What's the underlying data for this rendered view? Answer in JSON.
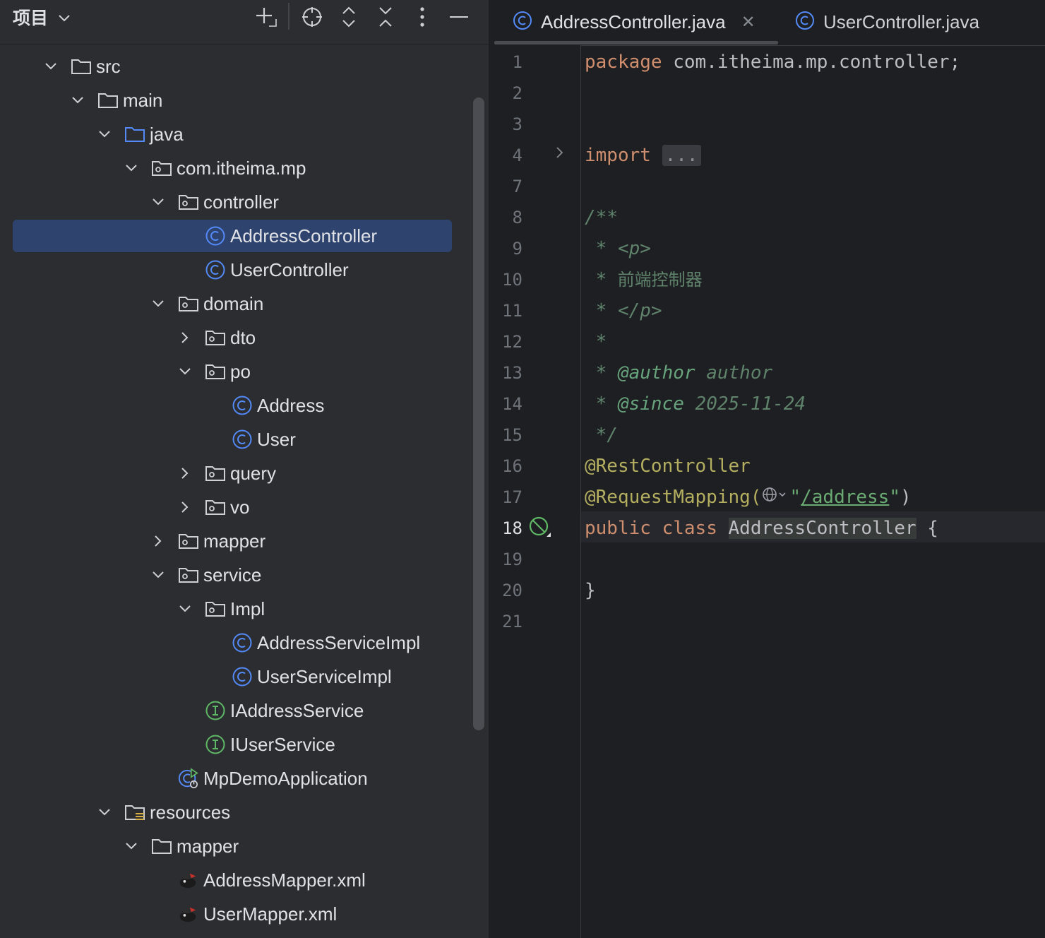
{
  "project_panel": {
    "title": "项目",
    "toolbar": [
      "add",
      "locate",
      "expand-all",
      "collapse-all",
      "options",
      "hide"
    ],
    "tree": [
      {
        "label": "src",
        "icon": "folder",
        "expanded": true
      },
      {
        "label": "main",
        "icon": "folder",
        "expanded": true
      },
      {
        "label": "java",
        "icon": "source-folder",
        "expanded": true
      },
      {
        "label": "com.itheima.mp",
        "icon": "package",
        "expanded": true
      },
      {
        "label": "controller",
        "icon": "package",
        "expanded": true
      },
      {
        "label": "AddressController",
        "icon": "class",
        "selected": true
      },
      {
        "label": "UserController",
        "icon": "class"
      },
      {
        "label": "domain",
        "icon": "package",
        "expanded": true
      },
      {
        "label": "dto",
        "icon": "package",
        "expanded": false
      },
      {
        "label": "po",
        "icon": "package",
        "expanded": true
      },
      {
        "label": "Address",
        "icon": "class"
      },
      {
        "label": "User",
        "icon": "class"
      },
      {
        "label": "query",
        "icon": "package",
        "expanded": false
      },
      {
        "label": "vo",
        "icon": "package",
        "expanded": false
      },
      {
        "label": "mapper",
        "icon": "package",
        "expanded": false
      },
      {
        "label": "service",
        "icon": "package",
        "expanded": true
      },
      {
        "label": "Impl",
        "icon": "package",
        "expanded": true
      },
      {
        "label": "AddressServiceImpl",
        "icon": "class"
      },
      {
        "label": "UserServiceImpl",
        "icon": "class"
      },
      {
        "label": "IAddressService",
        "icon": "interface"
      },
      {
        "label": "IUserService",
        "icon": "interface"
      },
      {
        "label": "MpDemoApplication",
        "icon": "spring-boot-class"
      },
      {
        "label": "resources",
        "icon": "resources-folder",
        "expanded": true
      },
      {
        "label": "mapper",
        "icon": "folder",
        "expanded": true
      },
      {
        "label": "AddressMapper.xml",
        "icon": "mybatis-xml"
      },
      {
        "label": "UserMapper.xml",
        "icon": "mybatis-xml"
      }
    ]
  },
  "editor": {
    "tabs": [
      {
        "label": "AddressController.java",
        "active": true,
        "icon": "class"
      },
      {
        "label": "UserController.java",
        "active": false,
        "icon": "class"
      }
    ],
    "current_line": "18",
    "lines": [
      {
        "n": "1",
        "text": "package com.itheima.mp.controller;"
      },
      {
        "n": "2",
        "text": ""
      },
      {
        "n": "3",
        "text": ""
      },
      {
        "n": "4",
        "text": "import ..."
      },
      {
        "n": "7",
        "text": ""
      },
      {
        "n": "8",
        "text": "/**"
      },
      {
        "n": "9",
        "text": " * <p>"
      },
      {
        "n": "10",
        "text": " *  前端控制器"
      },
      {
        "n": "11",
        "text": " * </p>"
      },
      {
        "n": "12",
        "text": " *"
      },
      {
        "n": "13",
        "text": " * @author author"
      },
      {
        "n": "14",
        "text": " * @since 2025-11-24"
      },
      {
        "n": "15",
        "text": " */"
      },
      {
        "n": "16",
        "text": "@RestController"
      },
      {
        "n": "17",
        "text": "@RequestMapping(\"/address\")"
      },
      {
        "n": "18",
        "text": "public class AddressController {"
      },
      {
        "n": "19",
        "text": ""
      },
      {
        "n": "20",
        "text": "}"
      },
      {
        "n": "21",
        "text": ""
      }
    ],
    "tokens": {
      "package_kw": "package",
      "package_name": " com.itheima.mp.controller;",
      "import_kw": "import",
      "import_fold": "...",
      "doc_open": "/**",
      "doc_p_open": " * <p>",
      "doc_star": " *",
      "doc_desc": "  前端控制器",
      "doc_p_close": " * </p>",
      "doc_empty": " *",
      "doc_author_tag": "@author",
      "doc_author_val": " author",
      "doc_since_tag": "@since",
      "doc_since_val": " 2025-11-24",
      "doc_close": " */",
      "ann_rest": "@RestController",
      "ann_req": "@RequestMapping(",
      "req_quote_open": "\"",
      "req_path": "/address",
      "req_quote_close": "\"",
      "req_close": ")",
      "public_kw": "public",
      "class_kw": "class",
      "class_name": "AddressController",
      "brace_open": " {",
      "brace_close": "}"
    }
  },
  "colors": {
    "panel_bg": "#2b2d30",
    "editor_bg": "#1e1f22",
    "selection": "#2e436e",
    "class_icon": "#548af7",
    "interface_icon": "#5fb865",
    "keyword": "#cf8e6d",
    "annotation": "#b3ae60",
    "doc_comment": "#5f826b"
  }
}
